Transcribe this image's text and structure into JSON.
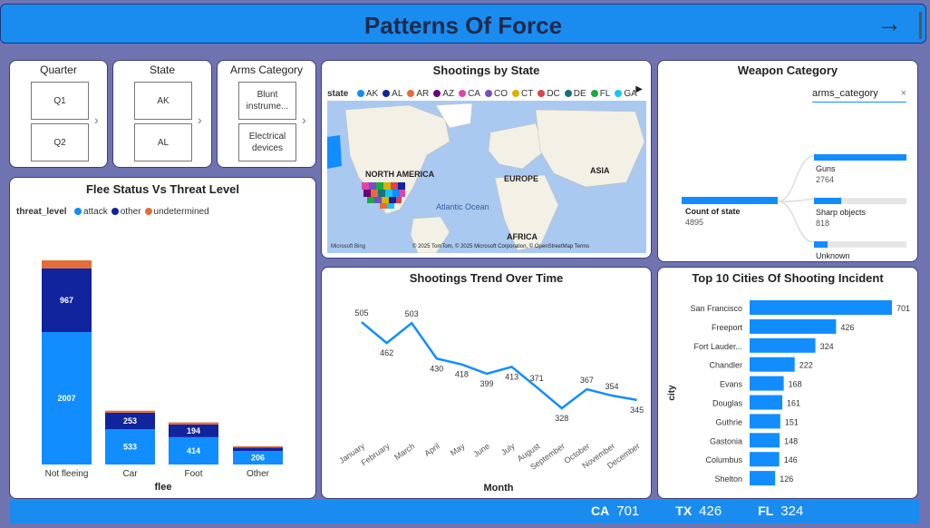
{
  "header": {
    "title": "Patterns Of Force"
  },
  "slicers": [
    {
      "title": "Quarter",
      "items": [
        "Q1",
        "Q2"
      ]
    },
    {
      "title": "State",
      "items": [
        "AK",
        "AL"
      ]
    },
    {
      "title": "Arms Category",
      "items": [
        "Blunt instrume...",
        "Electrical devices"
      ]
    }
  ],
  "map": {
    "title": "Shootings by State",
    "legend_label": "state",
    "legend": [
      {
        "name": "AK",
        "color": "#118dff"
      },
      {
        "name": "AL",
        "color": "#12239e"
      },
      {
        "name": "AR",
        "color": "#e66c37"
      },
      {
        "name": "AZ",
        "color": "#6b007b"
      },
      {
        "name": "CA",
        "color": "#e044a7"
      },
      {
        "name": "CO",
        "color": "#744ec2"
      },
      {
        "name": "CT",
        "color": "#d9b300"
      },
      {
        "name": "DC",
        "color": "#d64550"
      },
      {
        "name": "DE",
        "color": "#197278"
      },
      {
        "name": "FL",
        "color": "#1aab40"
      },
      {
        "name": "GA",
        "color": "#15c6f4"
      }
    ],
    "labels": {
      "na": "NORTH AMERICA",
      "eu": "EUROPE",
      "asia": "ASIA",
      "ocean": "Atlantic Ocean",
      "africa": "AFRICA"
    },
    "attribution": "© 2025 TomTom, © 2025 Microsoft Corporation, © OpenStreetMap  Terms",
    "bing": "Microsoft Bing"
  },
  "weapon": {
    "title": "Weapon Category",
    "field": "arms_category",
    "root": {
      "label": "Count of state",
      "value": "4895"
    },
    "branches": [
      {
        "label": "Guns",
        "value": "2764",
        "fraction": 1.0
      },
      {
        "label": "Sharp objects",
        "value": "818",
        "fraction": 0.296
      },
      {
        "label": "Unknown",
        "value": "",
        "fraction": 0.15
      }
    ]
  },
  "flee": {
    "title": "Flee Status Vs Threat Level",
    "legend_label": "threat_level",
    "xlabel": "flee"
  },
  "trend": {
    "title": "Shootings Trend Over Time",
    "xlabel": "Month"
  },
  "cities": {
    "title": "Top 10 Cities Of Shooting Incident",
    "ylabel": "city"
  },
  "footer": {
    "ticker": [
      {
        "state": "CA",
        "value": "701"
      },
      {
        "state": "TX",
        "value": "426"
      },
      {
        "state": "FL",
        "value": "324"
      }
    ]
  },
  "chart_data": [
    {
      "type": "bar",
      "stacked": true,
      "title": "Flee Status Vs Threat Level",
      "xlabel": "flee",
      "ylabel": "",
      "categories": [
        "Not fleeing",
        "Car",
        "Foot",
        "Other"
      ],
      "series": [
        {
          "name": "attack",
          "color": "#118dff",
          "values": [
            2007,
            533,
            414,
            206
          ]
        },
        {
          "name": "other",
          "color": "#12239e",
          "values": [
            967,
            253,
            194,
            50
          ]
        },
        {
          "name": "undetermined",
          "color": "#e66c37",
          "values": [
            120,
            30,
            30,
            20
          ]
        }
      ],
      "ylim": [
        0,
        3300
      ],
      "legend": "top-left"
    },
    {
      "type": "line",
      "title": "Shootings Trend Over Time",
      "xlabel": "Month",
      "ylabel": "",
      "x": [
        "January",
        "February",
        "March",
        "April",
        "May",
        "June",
        "July",
        "August",
        "September",
        "October",
        "November",
        "December"
      ],
      "values": [
        505,
        462,
        503,
        430,
        418,
        399,
        413,
        371,
        328,
        367,
        354,
        345
      ],
      "ylim": [
        300,
        520
      ],
      "color": "#118dff"
    },
    {
      "type": "bar",
      "orientation": "horizontal",
      "title": "Top 10 Cities Of Shooting Incident",
      "ylabel": "city",
      "categories": [
        "San Francisco",
        "Freeport",
        "Fort Lauder...",
        "Chandler",
        "Evans",
        "Douglas",
        "Guthrie",
        "Gastonia",
        "Columbus",
        "Shelton"
      ],
      "values": [
        701,
        426,
        324,
        222,
        168,
        161,
        151,
        148,
        146,
        126
      ],
      "xlim": [
        0,
        701
      ],
      "color": "#118dff"
    }
  ]
}
